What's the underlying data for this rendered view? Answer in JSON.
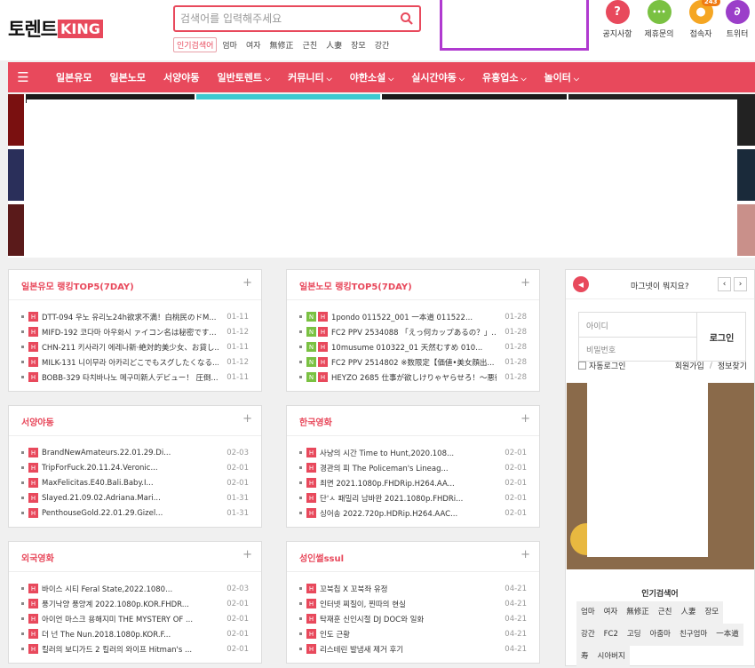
{
  "logo": {
    "main": "토렌트",
    "accent": "KING"
  },
  "search": {
    "placeholder": "검색어를 입력해주세요",
    "hot_label": "인기검색어",
    "keywords": [
      "엄마",
      "여자",
      "無修正",
      "근친",
      "人妻",
      "장모",
      "강간"
    ]
  },
  "top_icons": [
    {
      "label": "공지사항",
      "icon": "question-icon",
      "glyph": "?",
      "color": "#e8495c"
    },
    {
      "label": "제휴문의",
      "icon": "chat-icon",
      "glyph": "•••",
      "color": "#7ac142"
    },
    {
      "label": "접속자",
      "icon": "user-icon",
      "glyph": "●",
      "color": "#f5a623",
      "badge": "243"
    },
    {
      "label": "트위터",
      "icon": "link-icon",
      "glyph": "∂",
      "color": "#9b3ec9"
    }
  ],
  "nav": {
    "menu_icon": "☰",
    "items": [
      {
        "label": "일본유모",
        "dropdown": false
      },
      {
        "label": "일본노모",
        "dropdown": false
      },
      {
        "label": "서양야동",
        "dropdown": false
      },
      {
        "label": "일반토렌트",
        "dropdown": true
      },
      {
        "label": "커뮤니티",
        "dropdown": true
      },
      {
        "label": "야한소설",
        "dropdown": true
      },
      {
        "label": "실시간야동",
        "dropdown": true
      },
      {
        "label": "유흥업소",
        "dropdown": true
      },
      {
        "label": "놀이터",
        "dropdown": true
      }
    ]
  },
  "panels": {
    "jp_censored": {
      "title": "일본유모 랭킹TOP5(7DAY)",
      "items": [
        {
          "tags": [
            "H"
          ],
          "text": "DTT-094 우노 유리노24h欲求不満！白桃民のドM...",
          "date": "01-11"
        },
        {
          "tags": [
            "H"
          ],
          "text": "MIFD-192 코다마 아우화시 ァイコン名は秘密です...",
          "date": "01-12"
        },
        {
          "tags": [
            "H"
          ],
          "text": "CHN-211 키사라기 에레나新·絶対的美少女、お貸し...",
          "date": "01-11"
        },
        {
          "tags": [
            "H"
          ],
          "text": "MILK-131 니이무라 아카리どこでもスグしたくなる...",
          "date": "01-12"
        },
        {
          "tags": [
            "H"
          ],
          "text": "BOBB-329 타치바나노 메구미新人デビュー！ 圧倒...",
          "date": "01-11"
        }
      ]
    },
    "jp_uncensored": {
      "title": "일본노모 랭킹TOP5(7DAY)",
      "items": [
        {
          "tags": [
            "N",
            "H"
          ],
          "text": "1pondo 011522_001 一本道 011522...",
          "date": "01-28"
        },
        {
          "tags": [
            "N",
            "H"
          ],
          "text": "FC2 PPV 2534088 「えっ何カップあるの？」...",
          "date": "01-28"
        },
        {
          "tags": [
            "N",
            "H"
          ],
          "text": "10musume 010322_01 天然むすめ 010...",
          "date": "01-28"
        },
        {
          "tags": [
            "N",
            "H"
          ],
          "text": "FC2 PPV 2514802 ※数限定【価値•美女顔出...",
          "date": "01-28"
        },
        {
          "tags": [
            "N",
            "H"
          ],
          "text": "HEYZO 2685 仕事が欲しけりゃヤらせろ！～悪徳プ...",
          "date": "01-28"
        }
      ]
    },
    "western": {
      "title": "서양야동",
      "items": [
        {
          "tags": [
            "H"
          ],
          "text": "BrandNewAmateurs.22.01.29.Di...",
          "date": "02-03"
        },
        {
          "tags": [
            "H"
          ],
          "text": "TripForFuck.20.11.24.Veronic...",
          "date": "02-01"
        },
        {
          "tags": [
            "H"
          ],
          "text": "MaxFelicitas.E40.Bali.Baby.I...",
          "date": "02-01"
        },
        {
          "tags": [
            "H"
          ],
          "text": "Slayed.21.09.02.Adriana.Mari...",
          "date": "01-31"
        },
        {
          "tags": [
            "H"
          ],
          "text": "PenthouseGold.22.01.29.Gizel...",
          "date": "01-31"
        }
      ]
    },
    "korean_movies": {
      "title": "한국영화",
      "items": [
        {
          "tags": [
            "H"
          ],
          "text": "사냥의 시간 Time to Hunt,2020.108...",
          "date": "02-01"
        },
        {
          "tags": [
            "H"
          ],
          "text": "경관의 피 The Policeman's Lineag...",
          "date": "02-01"
        },
        {
          "tags": [
            "H"
          ],
          "text": "최면 2021.1080p.FHDRip.H264.AA...",
          "date": "02-01"
        },
        {
          "tags": [
            "H"
          ],
          "text": "단'ㅅ 패밀리 남바완 2021.1080p.FHDRi...",
          "date": "02-01"
        },
        {
          "tags": [
            "H"
          ],
          "text": "싱어송 2022.720p.HDRip.H264.AAC...",
          "date": "02-01"
        }
      ]
    },
    "foreign_movies": {
      "title": "외국영화",
      "items": [
        {
          "tags": [
            "H"
          ],
          "text": "바이스 시티 Feral State,2022.1080...",
          "date": "02-03"
        },
        {
          "tags": [
            "H"
          ],
          "text": "풍기낙양 풍양계 2022.1080p.KOR.FHDR...",
          "date": "02-01"
        },
        {
          "tags": [
            "H"
          ],
          "text": "아이언 마스크 용해지미 THE MYSTERY OF ...",
          "date": "02-01"
        },
        {
          "tags": [
            "H"
          ],
          "text": "더 넌 The Nun.2018.1080p.KOR.F...",
          "date": "02-01"
        },
        {
          "tags": [
            "H"
          ],
          "text": "킬러의 보디가드 2 킬러의 와이프 Hitman's ...",
          "date": "02-01"
        }
      ]
    },
    "adult_ssul": {
      "title": "성인썰ssul",
      "items": [
        {
          "tags": [
            "H"
          ],
          "text": "꼬북칩 X 꼬북좌 유정",
          "date": "04-21"
        },
        {
          "tags": [
            "H"
          ],
          "text": "인터넷 찌질이, 찐따의 현실",
          "date": "04-21"
        },
        {
          "tags": [
            "H"
          ],
          "text": "탁재훈 신인시절 DJ DOC와 일화",
          "date": "04-21"
        },
        {
          "tags": [
            "H"
          ],
          "text": "인도 근황",
          "date": "04-21"
        },
        {
          "tags": [
            "H"
          ],
          "text": "리스테린 발냄새 제거 후기",
          "date": "04-21"
        }
      ]
    }
  },
  "sidebar": {
    "question": "마그넷이 뭐지요?",
    "prev": "‹",
    "next": "›",
    "id_placeholder": "아이디",
    "pw_placeholder": "비밀번호",
    "login": "로그인",
    "auto_login": "자동로그인",
    "join": "회원가입",
    "separator": "/",
    "find": "정보찾기",
    "popular_title": "인기검색어",
    "popular": [
      "엄마",
      "여자",
      "無修正",
      "근친",
      "人妻",
      "장모",
      "강간",
      "FC2",
      "고딩",
      "아줌마",
      "친구엄마",
      "一本道",
      "寿",
      "시아버지"
    ]
  },
  "colors": {
    "accent": "#e8495c",
    "new_tag": "#7ac142",
    "banner_border": "#b03ad0"
  }
}
